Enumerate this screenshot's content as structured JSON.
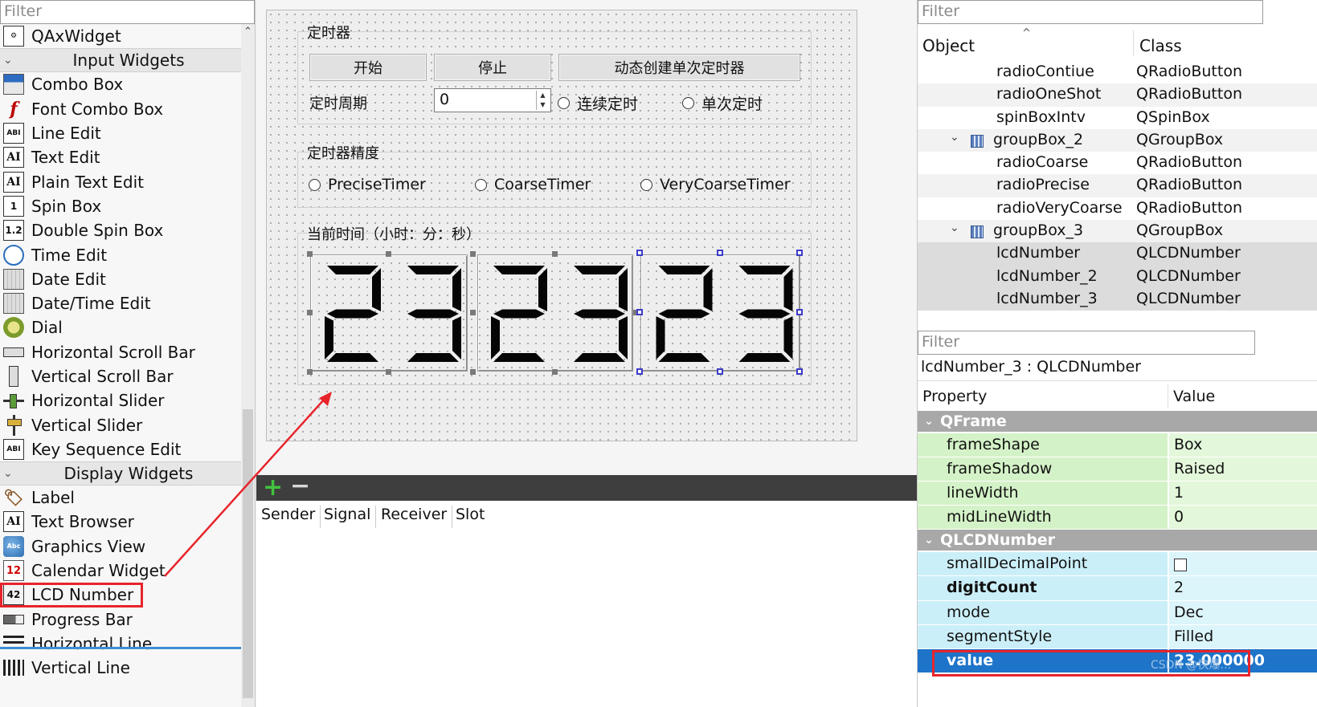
{
  "widget_box": {
    "filter_placeholder": "Filter",
    "top_item": "QAxWidget",
    "categories": [
      {
        "label": "Input Widgets",
        "items": [
          "Combo Box",
          "Font Combo Box",
          "Line Edit",
          "Text Edit",
          "Plain Text Edit",
          "Spin Box",
          "Double Spin Box",
          "Time Edit",
          "Date Edit",
          "Date/Time Edit",
          "Dial",
          "Horizontal Scroll Bar",
          "Vertical Scroll Bar",
          "Horizontal Slider",
          "Vertical Slider",
          "Key Sequence Edit"
        ]
      },
      {
        "label": "Display Widgets",
        "items": [
          "Label",
          "Text Browser",
          "Graphics View",
          "Calendar Widget",
          "LCD Number",
          "Progress Bar",
          "Horizontal Line",
          "Vertical Line"
        ]
      }
    ],
    "highlighted_item": "LCD Number",
    "icon_labels": {
      "line_edit": "ABI",
      "text_edit": "AI",
      "spin": "1",
      "double_spin": "1.2",
      "calendar": "12",
      "lcd": "42",
      "graphics": "Abc"
    }
  },
  "form": {
    "group_timer": {
      "title": "定时器",
      "buttons": [
        "开始",
        "停止",
        "动态创建单次定时器"
      ],
      "period_label": "定时周期",
      "spin_value": "0",
      "radio_continuous": "连续定时",
      "radio_single": "单次定时"
    },
    "group_precision": {
      "title": "定时器精度",
      "radios": [
        "PreciseTimer",
        "CoarseTimer",
        "VeryCoarseTimer"
      ]
    },
    "group_time": {
      "title": "当前时间（小时：分：秒）",
      "lcd_values": [
        "23",
        "23",
        "23"
      ]
    }
  },
  "signal_slot": {
    "columns": [
      "Sender",
      "Signal",
      "Receiver",
      "Slot"
    ]
  },
  "object_inspector": {
    "filter_placeholder": "Filter",
    "columns": {
      "object": "Object",
      "class": "Class"
    },
    "rows": [
      {
        "object": "radioContiue",
        "class": "QRadioButton",
        "level": 2
      },
      {
        "object": "radioOneShot",
        "class": "QRadioButton",
        "level": 2
      },
      {
        "object": "spinBoxIntv",
        "class": "QSpinBox",
        "level": 2
      },
      {
        "object": "groupBox_2",
        "class": "QGroupBox",
        "level": 1
      },
      {
        "object": "radioCoarse",
        "class": "QRadioButton",
        "level": 2
      },
      {
        "object": "radioPrecise",
        "class": "QRadioButton",
        "level": 2
      },
      {
        "object": "radioVeryCoarse",
        "class": "QRadioButton",
        "level": 2
      },
      {
        "object": "groupBox_3",
        "class": "QGroupBox",
        "level": 1
      },
      {
        "object": "lcdNumber",
        "class": "QLCDNumber",
        "level": 2
      },
      {
        "object": "lcdNumber_2",
        "class": "QLCDNumber",
        "level": 2
      },
      {
        "object": "lcdNumber_3",
        "class": "QLCDNumber",
        "level": 2
      }
    ]
  },
  "property_editor": {
    "filter_placeholder": "Filter",
    "object_title": "lcdNumber_3 : QLCDNumber",
    "columns": {
      "property": "Property",
      "value": "Value"
    },
    "sections": [
      {
        "name": "QFrame",
        "rows": [
          {
            "key": "frameShape",
            "value": "Box"
          },
          {
            "key": "frameShadow",
            "value": "Raised"
          },
          {
            "key": "lineWidth",
            "value": "1"
          },
          {
            "key": "midLineWidth",
            "value": "0"
          }
        ]
      },
      {
        "name": "QLCDNumber",
        "rows": [
          {
            "key": "smallDecimalPoint",
            "value": ""
          },
          {
            "key": "digitCount",
            "value": "2"
          },
          {
            "key": "mode",
            "value": "Dec"
          },
          {
            "key": "segmentStyle",
            "value": "Filled"
          },
          {
            "key": "value",
            "value": "23.000000"
          }
        ]
      }
    ],
    "watermark": "CSDN @快爆…"
  }
}
